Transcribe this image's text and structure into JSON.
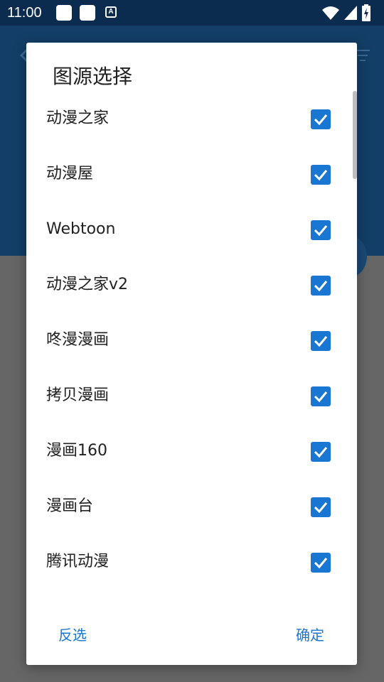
{
  "status_bar": {
    "time": "11:00",
    "notif_a_glyph": "A",
    "icons": [
      "notification-square-icon",
      "notification-square-icon",
      "a-notification-icon",
      "wifi-icon",
      "signal-icon",
      "battery-charging-icon"
    ]
  },
  "colors": {
    "status_bar": "#0b2b4f",
    "app_header": "#133e67",
    "scrim": "#666666",
    "accent": "#1976d2",
    "dialog_bg": "#ffffff",
    "text": "#212121"
  },
  "dialog": {
    "title": "图源选择",
    "items": [
      {
        "label": "动漫之家",
        "checked": true
      },
      {
        "label": "动漫屋",
        "checked": true
      },
      {
        "label": "Webtoon",
        "checked": true
      },
      {
        "label": "动漫之家v2",
        "checked": true
      },
      {
        "label": "咚漫漫画",
        "checked": true
      },
      {
        "label": "拷贝漫画",
        "checked": true
      },
      {
        "label": "漫画160",
        "checked": true
      },
      {
        "label": "漫画台",
        "checked": true
      },
      {
        "label": "腾讯动漫",
        "checked": true
      }
    ],
    "buttons": {
      "invert": "反选",
      "confirm": "确定"
    }
  }
}
